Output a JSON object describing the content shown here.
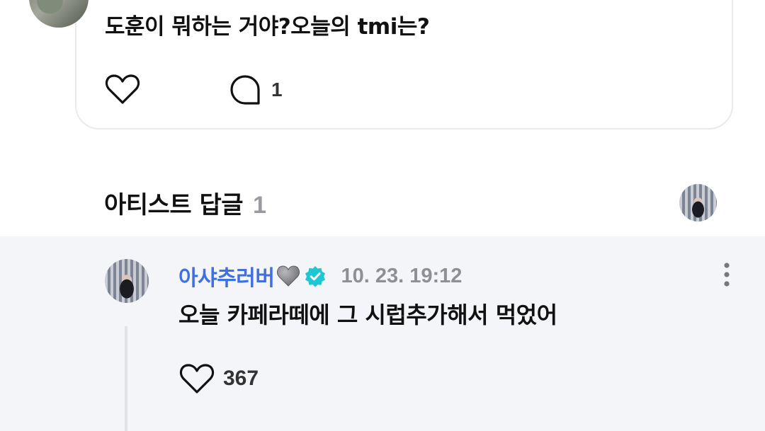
{
  "post": {
    "text": "도훈이 뭐하는 거야?오늘의 tmi는?",
    "comment_count": "1",
    "icons": {
      "like": "heart-outline-icon",
      "comment": "speech-bubble-icon"
    }
  },
  "artist_replies": {
    "title": "아티스트 답글",
    "count": "1"
  },
  "reply": {
    "username": "아샤추러버",
    "username_emoji": "grey-heart-icon",
    "badge": "verified-badge-icon",
    "date": "10. 23. 19:12",
    "text": "오늘 카페라떼에 그 시럽추가해서 먹었어",
    "like_count": "367"
  },
  "colors": {
    "username": "#3f6fe0",
    "verified": "#1fc7d4",
    "muted_text": "#8e8f95",
    "panel_bg": "#f4f5f8",
    "card_border": "#e9e9ee"
  }
}
